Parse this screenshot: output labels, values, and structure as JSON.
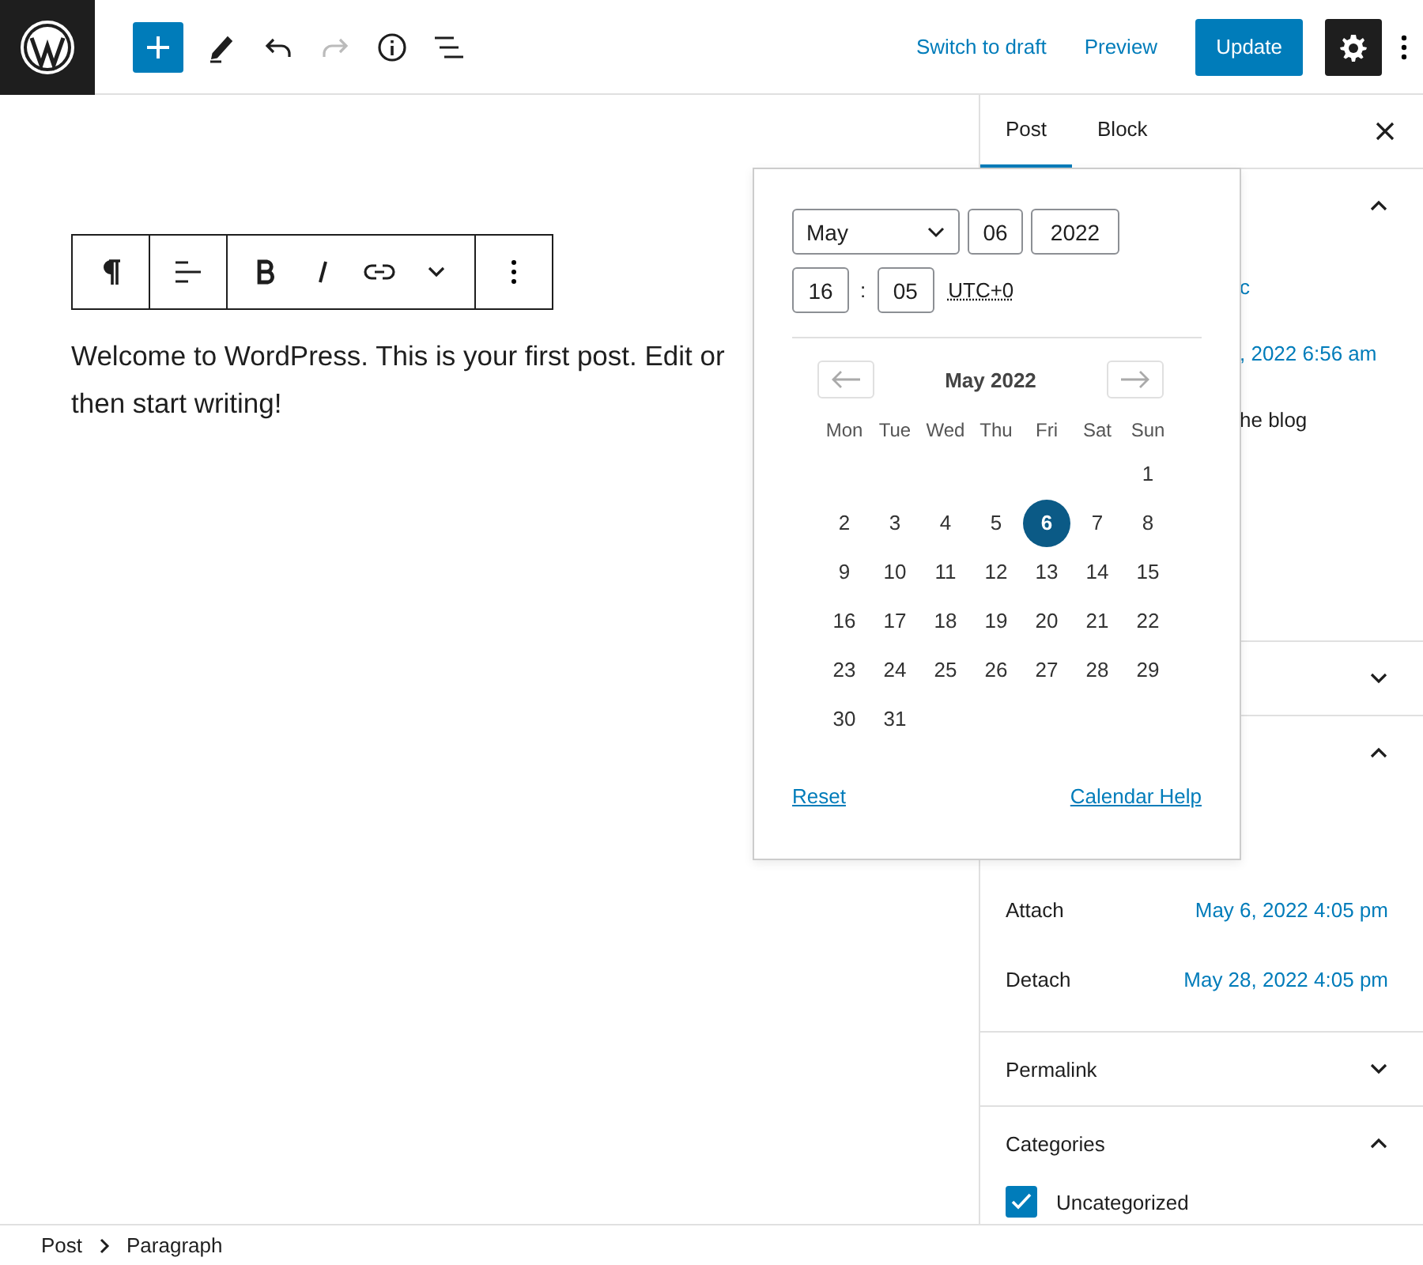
{
  "header": {
    "tools": [
      {
        "kind": "add",
        "disabled": false
      },
      {
        "kind": "edit",
        "disabled": false
      },
      {
        "kind": "undo",
        "disabled": false
      },
      {
        "kind": "redo",
        "disabled": true
      },
      {
        "kind": "info",
        "disabled": false
      },
      {
        "kind": "list",
        "disabled": false
      }
    ],
    "links": [
      "Switch to draft",
      "Preview"
    ],
    "primary": "Update",
    "settings_pressed": true
  },
  "paragraph_lines": [
    "Welcome to WordPress. This is your first post. Edit or",
    "then start writing!"
  ],
  "date_popover": {
    "month": "May",
    "day": "06",
    "year": "2022",
    "hour": "16",
    "minute": "05",
    "separator": ":",
    "timezone": "UTC+0",
    "calendar": {
      "title": "May 2022",
      "weekdays": [
        "Mon",
        "Tue",
        "Wed",
        "Thu",
        "Fri",
        "Sat",
        "Sun"
      ],
      "weeks": [
        [
          {
            "label": "1",
            "selected": false
          }
        ],
        [
          {
            "label": "2",
            "selected": false
          },
          {
            "label": "3",
            "selected": false
          },
          {
            "label": "4",
            "selected": false
          },
          {
            "label": "5",
            "selected": false
          },
          {
            "label": "6",
            "selected": true
          },
          {
            "label": "7",
            "selected": false
          },
          {
            "label": "8",
            "selected": false
          }
        ],
        [
          {
            "label": "9",
            "selected": false
          },
          {
            "label": "10",
            "selected": false
          },
          {
            "label": "11",
            "selected": false
          },
          {
            "label": "12",
            "selected": false
          },
          {
            "label": "13",
            "selected": false
          },
          {
            "label": "14",
            "selected": false
          },
          {
            "label": "15",
            "selected": false
          }
        ],
        [
          {
            "label": "16",
            "selected": false
          },
          {
            "label": "17",
            "selected": false
          },
          {
            "label": "18",
            "selected": false
          },
          {
            "label": "19",
            "selected": false
          },
          {
            "label": "20",
            "selected": false
          },
          {
            "label": "21",
            "selected": false
          },
          {
            "label": "22",
            "selected": false
          }
        ],
        [
          {
            "label": "23",
            "selected": false
          },
          {
            "label": "24",
            "selected": false
          },
          {
            "label": "25",
            "selected": false
          },
          {
            "label": "26",
            "selected": false
          },
          {
            "label": "27",
            "selected": false
          },
          {
            "label": "28",
            "selected": false
          },
          {
            "label": "29",
            "selected": false
          }
        ],
        [
          {
            "label": "30",
            "selected": false
          },
          {
            "label": "31",
            "selected": false
          }
        ]
      ]
    },
    "reset": "Reset",
    "help": "Calendar Help"
  },
  "sidebar": {
    "tabs": [
      {
        "label": "Post",
        "selected": true
      },
      {
        "label": "Block",
        "selected": false
      }
    ],
    "panels": [
      {
        "expanded": true,
        "rows": [
          {
            "kind": "link",
            "text": "c"
          },
          {
            "kind": "link",
            "text": ", 2022 6:56 am"
          },
          {
            "kind": "text",
            "text": "he blog"
          }
        ]
      },
      {
        "expanded": false
      },
      {
        "expanded": true,
        "pairs": [
          {
            "label": "Attach",
            "value": "May 6, 2022 4:05 pm"
          },
          {
            "label": "Detach",
            "value": "May 28, 2022 4:05 pm"
          }
        ]
      },
      {
        "title": "Permalink",
        "expanded": false
      },
      {
        "title": "Categories",
        "expanded": true,
        "categories": [
          {
            "label": "Uncategorized",
            "checked": true
          }
        ]
      }
    ]
  },
  "breadcrumb": [
    "Post",
    "Paragraph"
  ]
}
